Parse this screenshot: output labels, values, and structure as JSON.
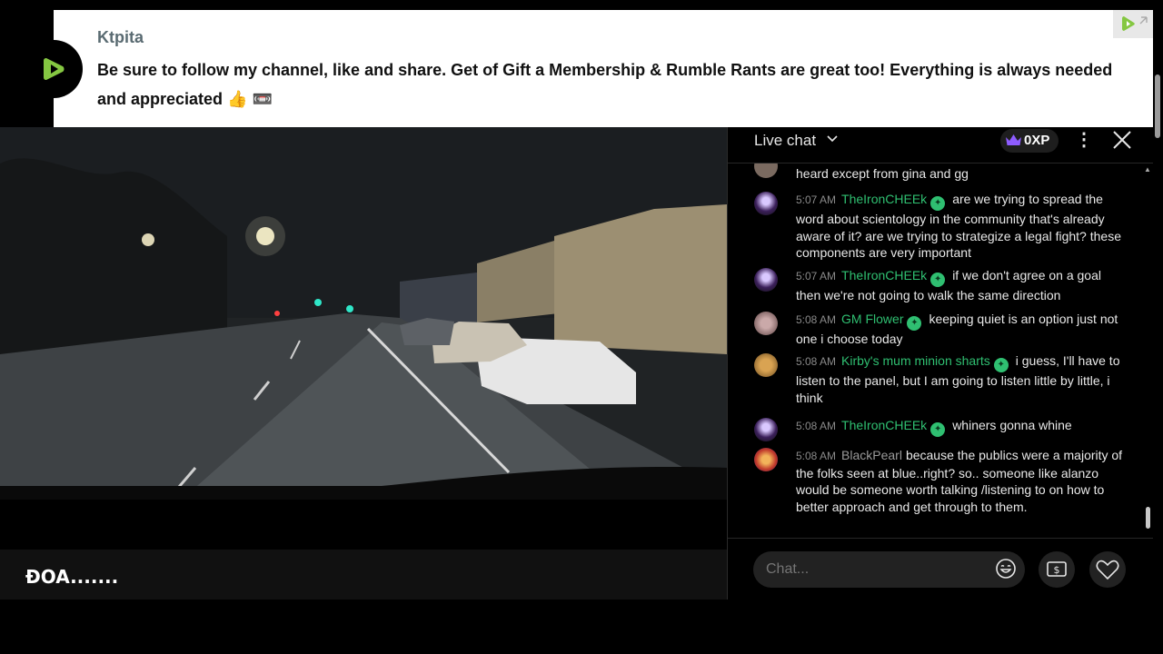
{
  "banner": {
    "author": "Ktpita",
    "message": "Be sure to follow my channel, like and share. Get of Gift a Membership & Rumble Rants are great too! Everything is always needed and appreciated 👍 📼"
  },
  "video": {
    "title": "ĐOA......."
  },
  "chat": {
    "header_title": "Live chat",
    "xp_label": "0XP",
    "input_placeholder": "Chat...",
    "messages": [
      {
        "time": "",
        "user": "",
        "text": "heard except from gina and gg",
        "user_color": "#2fbf71"
      },
      {
        "time": "5:07 AM",
        "user": "TheIronCHEEk",
        "text": "are we trying to spread the word about scientology in the community that's already aware of it? are we trying to strategize a legal fight? these components are very important",
        "user_color": "#2fbf71"
      },
      {
        "time": "5:07 AM",
        "user": "TheIronCHEEk",
        "text": "if we don't agree on a goal then we're not going to walk the same direction",
        "user_color": "#2fbf71"
      },
      {
        "time": "5:08 AM",
        "user": "GM Flower",
        "text": "keeping quiet is an option just not one i choose today",
        "user_color": "#2fbf71"
      },
      {
        "time": "5:08 AM",
        "user": "Kirby's mum minion sharts",
        "text": "i guess, I'll have to listen to the panel, but I am going to listen little by little, i think",
        "user_color": "#2fbf71"
      },
      {
        "time": "5:08 AM",
        "user": "TheIronCHEEk",
        "text": "whiners gonna whine",
        "user_color": "#2fbf71"
      },
      {
        "time": "5:08 AM",
        "user": "BlackPearl",
        "text": "because the publics were a majority of the folks seen at blue..right? so.. someone like alanzo would be someone worth talking /listening to on how to better approach and get through to them.",
        "user_color": "#9a9a9a"
      }
    ]
  },
  "colors": {
    "accent": "#85c742",
    "verified": "#2fbf71",
    "xp_crown": "#8e5cff"
  }
}
